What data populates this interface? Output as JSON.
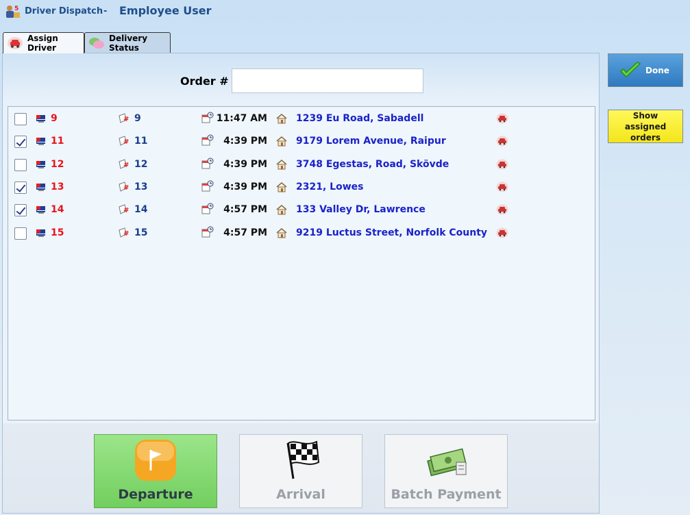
{
  "app": {
    "title": "Driver Dispatch",
    "separator": "-",
    "user_title": "Employee User"
  },
  "tabs": [
    {
      "label": "Assign Driver",
      "active": true,
      "icon": "car-icon"
    },
    {
      "label": "Delivery Status",
      "active": false,
      "icon": "speech-bubble-icon"
    }
  ],
  "order_search": {
    "label": "Order #",
    "value": ""
  },
  "orders": [
    {
      "checked": false,
      "id": "9",
      "number": "9",
      "time": "11:47 AM",
      "address": "1239 Eu Road, Sabadell"
    },
    {
      "checked": true,
      "id": "11",
      "number": "11",
      "time": "4:39 PM",
      "address": "9179 Lorem Avenue, Raipur"
    },
    {
      "checked": false,
      "id": "12",
      "number": "12",
      "time": "4:39 PM",
      "address": "3748 Egestas, Road, Skövde"
    },
    {
      "checked": true,
      "id": "13",
      "number": "13",
      "time": "4:39 PM",
      "address": "2321, Lowes"
    },
    {
      "checked": true,
      "id": "14",
      "number": "14",
      "time": "4:57 PM",
      "address": "133  Valley Dr, Lawrence"
    },
    {
      "checked": false,
      "id": "15",
      "number": "15",
      "time": "4:57 PM",
      "address": "9219 Luctus Street, Norfolk County"
    }
  ],
  "actions": {
    "departure": "Departure",
    "arrival": "Arrival",
    "batch_payment": "Batch Payment"
  },
  "side": {
    "done": "Done",
    "show_assigned": "Show assigned orders"
  },
  "colors": {
    "order_id": "#e8141a",
    "order_number": "#1b3d8a",
    "address": "#1a22c8",
    "done_button": "#3a86cc",
    "assigned_button": "#f7ec2a",
    "departure_button": "#82d96f"
  }
}
